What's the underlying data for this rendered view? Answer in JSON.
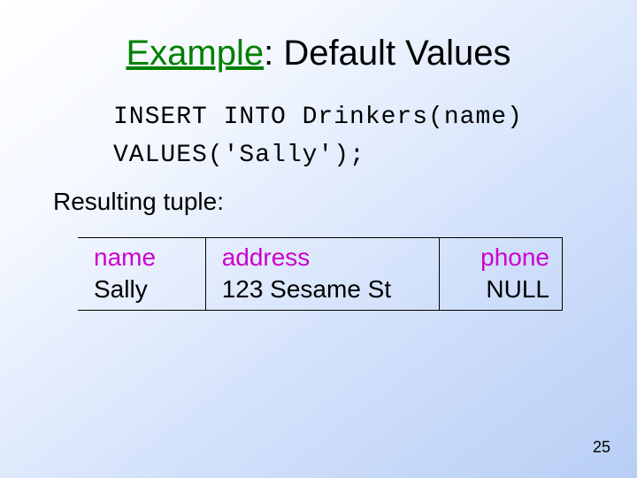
{
  "title": {
    "word1": "Example",
    "rest": ": Default Values"
  },
  "code": {
    "line1": "INSERT INTO Drinkers(name)",
    "line2": "VALUES('Sally');"
  },
  "subhead": "Resulting tuple:",
  "table": {
    "col1": {
      "header": "name",
      "value": "Sally"
    },
    "col2": {
      "header": "address",
      "value": "123 Sesame St"
    },
    "col3": {
      "header": "phone",
      "value": "NULL"
    }
  },
  "page_number": "25"
}
